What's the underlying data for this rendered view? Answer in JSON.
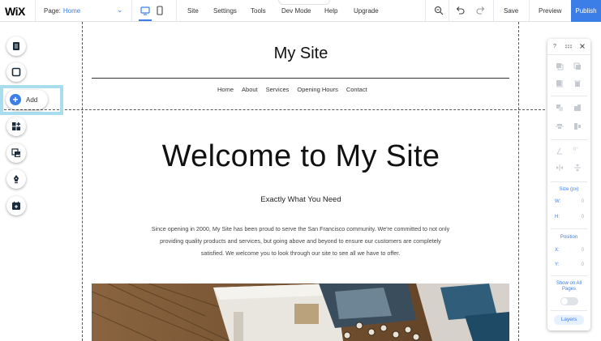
{
  "topbar": {
    "logo": "WiX",
    "page_label": "Page:",
    "page_value": "Home",
    "menu": [
      "Site",
      "Settings",
      "Tools",
      "Dev Mode",
      "Help",
      "Upgrade"
    ],
    "save": "Save",
    "preview": "Preview",
    "publish": "Publish",
    "accent_color": "#3b7ee8"
  },
  "left_toolbar": {
    "add_label": "Add",
    "items": [
      "pages-icon",
      "background-icon",
      "add-icon",
      "add-apps-icon",
      "media-icon",
      "blog-icon",
      "bookings-icon"
    ]
  },
  "site": {
    "title": "My Site",
    "nav": [
      "Home",
      "About",
      "Services",
      "Opening Hours",
      "Contact"
    ],
    "hero_title": "Welcome to My Site",
    "hero_subtitle": "Exactly What You Need",
    "hero_body_1": "Since opening in 2000, My Site has been proud to serve the San Francisco community. We're committed to not only",
    "hero_body_2": "providing quality products and services, but going above and beyond to ensure our customers are completely",
    "hero_body_3": "satisfied. We welcome you to look through our site to see all we have to offer."
  },
  "right_panel": {
    "help": "?",
    "rotation_value": "0°",
    "size_label": "Size (px)",
    "w_label": "W:",
    "w_value": "0",
    "h_label": "H:",
    "h_value": "0",
    "position_label": "Position",
    "x_label": "X:",
    "x_value": "0",
    "y_label": "Y:",
    "y_value": "0",
    "show_on_all_line1": "Show on All",
    "show_on_all_line2": "Pages",
    "layers": "Layers"
  }
}
